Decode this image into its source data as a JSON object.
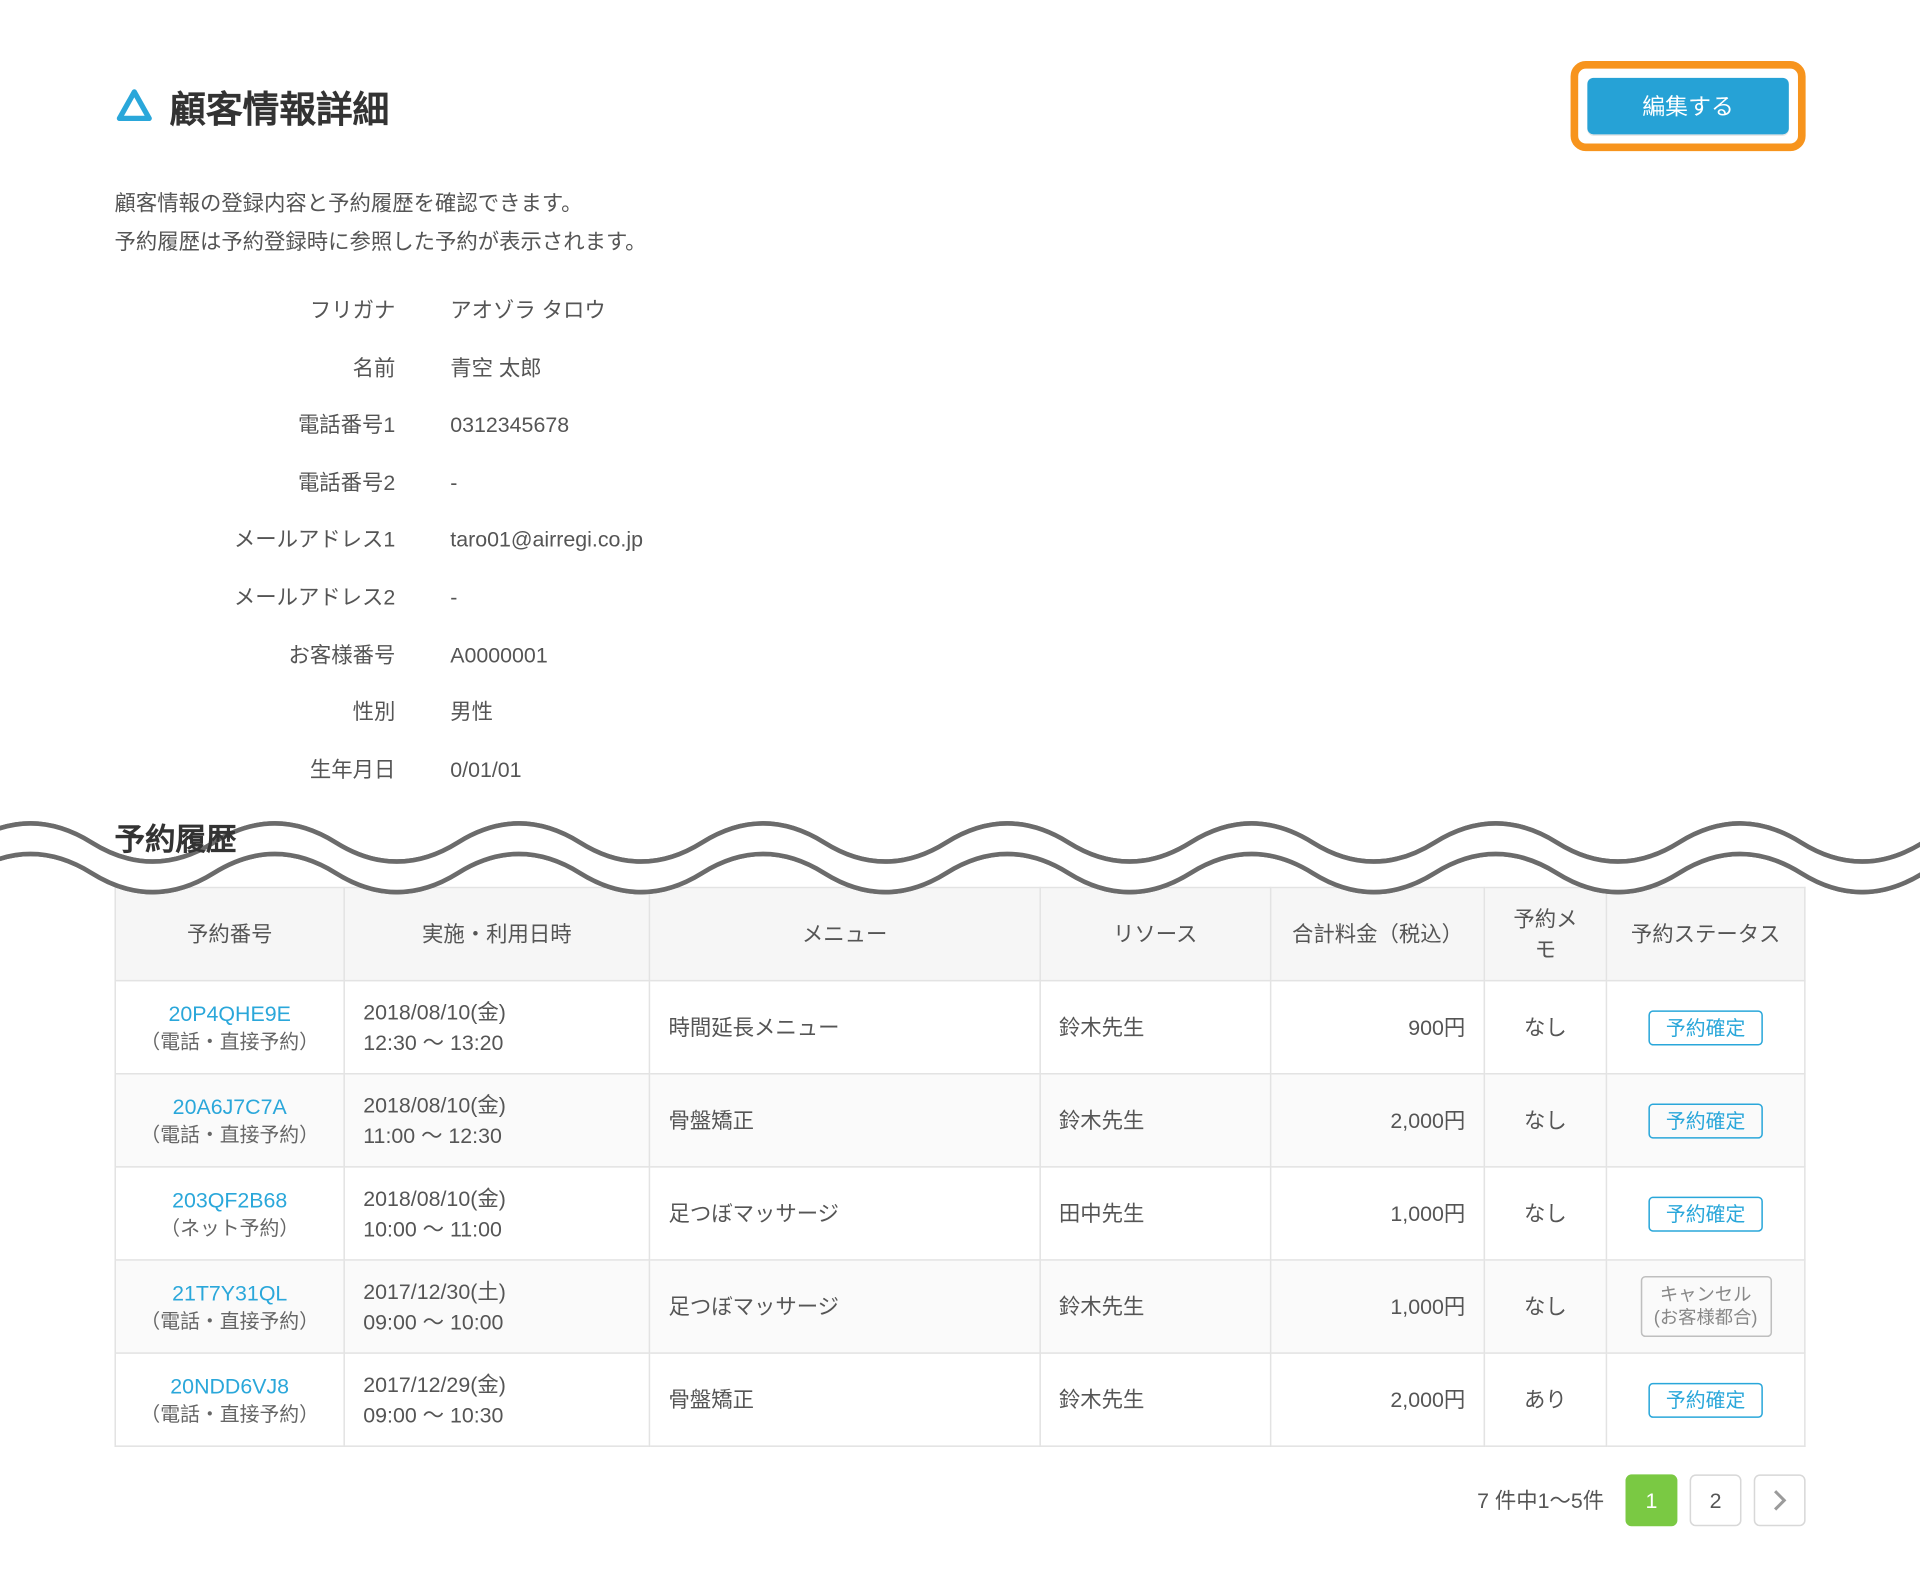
{
  "header": {
    "title": "顧客情報詳細",
    "editButton": "編集する"
  },
  "description": {
    "line1": "顧客情報の登録内容と予約履歴を確認できます。",
    "line2": "予約履歴は予約登録時に参照した予約が表示されます。"
  },
  "customer": {
    "furiganaLabel": "フリガナ",
    "furiganaValue": "アオゾラ タロウ",
    "nameLabel": "名前",
    "nameValue": "青空 太郎",
    "tel1Label": "電話番号1",
    "tel1Value": "0312345678",
    "tel2Label": "電話番号2",
    "tel2Value": "-",
    "email1Label": "メールアドレス1",
    "email1Value": "taro01@airregi.co.jp",
    "email2Label": "メールアドレス2",
    "email2Value": "-",
    "custNoLabel": "お客様番号",
    "custNoValue": "A0000001",
    "genderLabel": "性別",
    "genderValue": "男性",
    "birthLabel": "生年月日",
    "birthValue": "0/01/01"
  },
  "historyTitle": "予約履歴",
  "columns": {
    "reserveNo": "予約番号",
    "datetime": "実施・利用日時",
    "menu": "メニュー",
    "resource": "リソース",
    "price": "合計料金（税込）",
    "memo": "予約メモ",
    "status": "予約ステータス"
  },
  "rows": [
    {
      "reserveNo": "20P4QHE9E",
      "reserveSub": "（電話・直接予約）",
      "date": "2018/08/10(金)",
      "time": "12:30 ～ 13:20",
      "menu": "時間延長メニュー",
      "resource": "鈴木先生",
      "price": "900円",
      "memo": "なし",
      "status": "予約確定",
      "statusType": "confirmed"
    },
    {
      "reserveNo": "20A6J7C7A",
      "reserveSub": "（電話・直接予約）",
      "date": "2018/08/10(金)",
      "time": "11:00 ～ 12:30",
      "menu": "骨盤矯正",
      "resource": "鈴木先生",
      "price": "2,000円",
      "memo": "なし",
      "status": "予約確定",
      "statusType": "confirmed"
    },
    {
      "reserveNo": "203QF2B68",
      "reserveSub": "（ネット予約）",
      "date": "2018/08/10(金)",
      "time": "10:00 ～ 11:00",
      "menu": "足つぼマッサージ",
      "resource": "田中先生",
      "price": "1,000円",
      "memo": "なし",
      "status": "予約確定",
      "statusType": "confirmed"
    },
    {
      "reserveNo": "21T7Y31QL",
      "reserveSub": "（電話・直接予約）",
      "date": "2017/12/30(土)",
      "time": "09:00 ～ 10:00",
      "menu": "足つぼマッサージ",
      "resource": "鈴木先生",
      "price": "1,000円",
      "memo": "なし",
      "status": "キャンセル\n(お客様都合)",
      "statusType": "cancel"
    },
    {
      "reserveNo": "20NDD6VJ8",
      "reserveSub": "（電話・直接予約）",
      "date": "2017/12/29(金)",
      "time": "09:00 ～ 10:30",
      "menu": "骨盤矯正",
      "resource": "鈴木先生",
      "price": "2,000円",
      "memo": "あり",
      "status": "予約確定",
      "statusType": "confirmed"
    }
  ],
  "pager": {
    "summary": "7 件中1～5件",
    "page1": "1",
    "page2": "2"
  }
}
